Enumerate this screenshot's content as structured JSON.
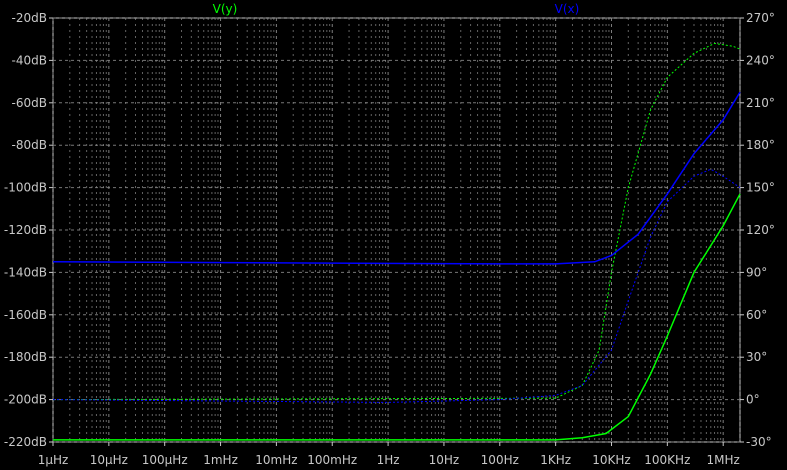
{
  "chart_data": {
    "type": "line",
    "x_scale": "log",
    "x_unit": "Hz",
    "xlim": [
      1e-06,
      2000000
    ],
    "x_ticks": [
      {
        "v": 1e-06,
        "label": "1µHz"
      },
      {
        "v": 1e-05,
        "label": "10µHz"
      },
      {
        "v": 0.0001,
        "label": "100µHz"
      },
      {
        "v": 0.001,
        "label": "1mHz"
      },
      {
        "v": 0.01,
        "label": "10mHz"
      },
      {
        "v": 0.1,
        "label": "100mHz"
      },
      {
        "v": 1,
        "label": "1Hz"
      },
      {
        "v": 10,
        "label": "10Hz"
      },
      {
        "v": 100,
        "label": "100Hz"
      },
      {
        "v": 1000,
        "label": "1KHz"
      },
      {
        "v": 10000,
        "label": "10KHz"
      },
      {
        "v": 100000,
        "label": "100KHz"
      },
      {
        "v": 1000000,
        "label": "1MHz"
      }
    ],
    "y_left": {
      "unit": "dB",
      "lim": [
        -220,
        -20
      ],
      "ticks": [
        -20,
        -40,
        -60,
        -80,
        -100,
        -120,
        -140,
        -160,
        -180,
        -200,
        -220
      ],
      "tick_labels": [
        "-20dB",
        "-40dB",
        "-60dB",
        "-80dB",
        "-100dB",
        "-120dB",
        "-140dB",
        "-160dB",
        "-180dB",
        "-200dB",
        "-220dB"
      ]
    },
    "y_right": {
      "unit": "°",
      "lim": [
        -30,
        270
      ],
      "ticks": [
        270,
        240,
        210,
        180,
        150,
        120,
        90,
        60,
        30,
        0,
        -30
      ],
      "tick_labels": [
        "270°",
        "240°",
        "210°",
        "180°",
        "150°",
        "120°",
        "90°",
        "60°",
        "30°",
        "0°",
        "-30°"
      ]
    },
    "grid": true,
    "series": [
      {
        "name": "V(y)",
        "color": "#00ff00",
        "magnitude": [
          [
            1e-06,
            -219
          ],
          [
            1000,
            -219
          ],
          [
            3000,
            -218
          ],
          [
            8000,
            -216
          ],
          [
            20000,
            -208
          ],
          [
            50000,
            -188
          ],
          [
            100000,
            -170
          ],
          [
            300000,
            -140
          ],
          [
            1000000,
            -118
          ],
          [
            2000000,
            -103
          ]
        ],
        "phase": [
          [
            1e-06,
            0
          ],
          [
            1000,
            1
          ],
          [
            3000,
            10
          ],
          [
            6000,
            35
          ],
          [
            10000,
            90
          ],
          [
            20000,
            150
          ],
          [
            50000,
            205
          ],
          [
            100000,
            228
          ],
          [
            300000,
            245
          ],
          [
            700000,
            252
          ],
          [
            1500000,
            250
          ],
          [
            2000000,
            248
          ]
        ]
      },
      {
        "name": "V(x)",
        "color": "#0000ff",
        "magnitude": [
          [
            1e-06,
            -135
          ],
          [
            100,
            -136
          ],
          [
            1000,
            -136
          ],
          [
            5000,
            -135
          ],
          [
            10000,
            -132
          ],
          [
            30000,
            -122
          ],
          [
            100000,
            -103
          ],
          [
            300000,
            -84
          ],
          [
            1000000,
            -68
          ],
          [
            2000000,
            -55
          ]
        ],
        "phase": [
          [
            1e-06,
            0
          ],
          [
            0.001,
            -1
          ],
          [
            1,
            -2
          ],
          [
            100,
            0
          ],
          [
            1000,
            3
          ],
          [
            3000,
            10
          ],
          [
            10000,
            35
          ],
          [
            20000,
            70
          ],
          [
            50000,
            115
          ],
          [
            100000,
            140
          ],
          [
            300000,
            158
          ],
          [
            600000,
            163
          ],
          [
            1000000,
            158
          ],
          [
            2000000,
            150
          ]
        ]
      }
    ]
  }
}
